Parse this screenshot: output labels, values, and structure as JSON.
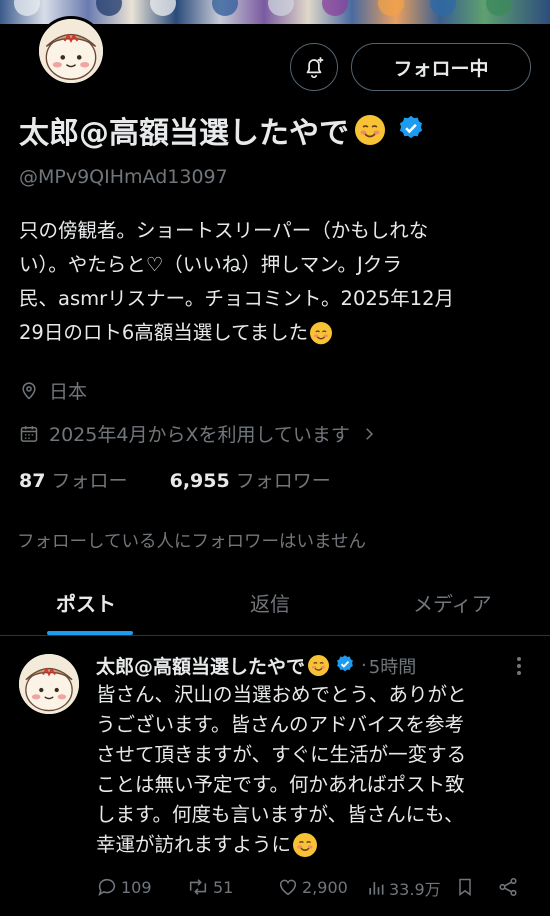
{
  "profile": {
    "name": "太郎@高額当選したやで",
    "handle": "@MPv9QIHmAd13097",
    "bio_lines": [
      "只の傍観者。ショートスリーパー（かもしれな",
      "い）。やたらと♡（いいね）押しマン。Jクラ",
      "民、asmrリスナー。チョコミント。2025年12月",
      "29日のロト6高額当選してました"
    ],
    "location": "日本",
    "joined": "2025年4月からXを利用しています",
    "following_count": "87",
    "following_label": "フォロー",
    "followers_count": "6,955",
    "followers_label": "フォロワー",
    "no_common_followers": "フォローしている人にフォロワーはいません"
  },
  "buttons": {
    "follow_label": "フォロー中"
  },
  "tabs": [
    {
      "label": "ポスト",
      "active": true
    },
    {
      "label": "返信",
      "active": false
    },
    {
      "label": "メディア",
      "active": false
    }
  ],
  "post": {
    "name": "太郎@高額当選したやで",
    "separator": "·",
    "time": "5時間",
    "text_lines": [
      "皆さん、沢山の当選おめでとう、ありがと",
      "うございます。皆さんのアドバイスを参考",
      "させて頂きますが、すぐに生活が一変する",
      "ことは無い予定です。何かあればポスト致",
      "します。何度も言いますが、皆さんにも、",
      "幸運が訪れますように"
    ],
    "replies": "109",
    "reposts": "51",
    "likes": "2,900",
    "views": "33.9万"
  },
  "icons": {
    "notification": "bell-plus-icon",
    "verified": "verified-badge-icon",
    "location": "location-pin-icon",
    "calendar": "calendar-icon",
    "chevron": "chevron-right-icon",
    "more": "more-vertical-icon",
    "reply": "reply-icon",
    "repost": "repost-icon",
    "like": "heart-icon",
    "views": "views-icon",
    "bookmark": "bookmark-icon",
    "share": "share-icon",
    "emoji": "smiling-face-emoji"
  },
  "colors": {
    "background": "#000000",
    "text": "#e7e9ea",
    "secondary_text": "#71767b",
    "accent": "#1d9bf0",
    "border": "#2f3336",
    "button_border": "#536471",
    "emoji": "#f7c234"
  }
}
